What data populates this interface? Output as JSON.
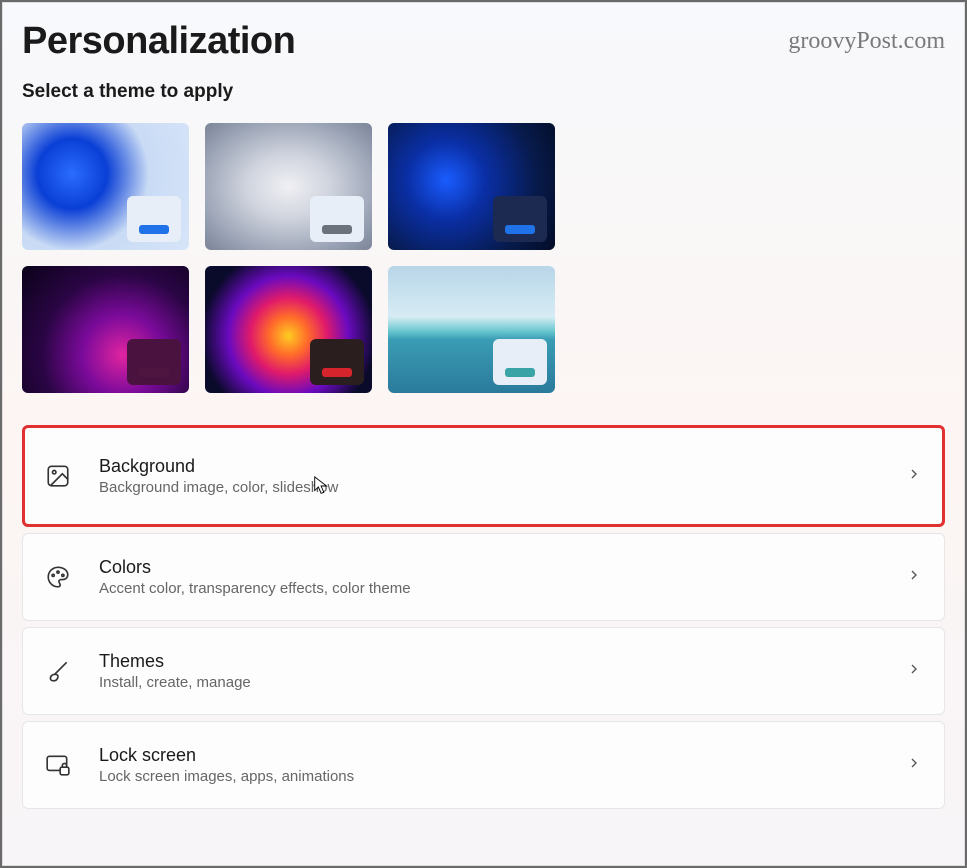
{
  "header": {
    "title": "Personalization",
    "watermark": "groovyPost.com"
  },
  "themes": {
    "section_title": "Select a theme to apply",
    "items": [
      {
        "name": "windows-light",
        "badge_bg": "#e7eef7",
        "accent": "#1f72e8"
      },
      {
        "name": "windows-grey",
        "badge_bg": "#e7eef7",
        "accent": "#6b727b"
      },
      {
        "name": "windows-dark",
        "badge_bg": "#1c2a52",
        "accent": "#1f72e8"
      },
      {
        "name": "glow",
        "badge_bg": "#4a133f",
        "accent": "#4e1540"
      },
      {
        "name": "captured-motion",
        "badge_bg": "#2b1e1e",
        "accent": "#d5242b"
      },
      {
        "name": "sunrise",
        "badge_bg": "#e7eef7",
        "accent": "#3aa3a6"
      }
    ]
  },
  "settings": [
    {
      "icon": "image-icon",
      "title": "Background",
      "subtitle": "Background image, color, slideshow",
      "highlighted": true
    },
    {
      "icon": "palette-icon",
      "title": "Colors",
      "subtitle": "Accent color, transparency effects, color theme",
      "highlighted": false
    },
    {
      "icon": "brush-icon",
      "title": "Themes",
      "subtitle": "Install, create, manage",
      "highlighted": false
    },
    {
      "icon": "monitor-lock-icon",
      "title": "Lock screen",
      "subtitle": "Lock screen images, apps, animations",
      "highlighted": false
    }
  ]
}
